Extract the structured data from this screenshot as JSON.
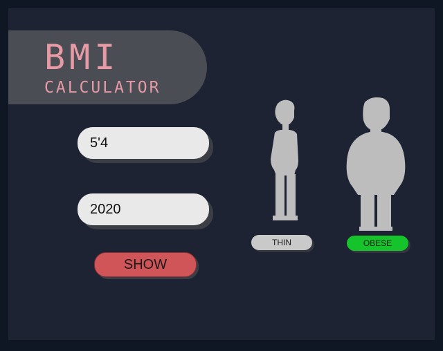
{
  "app": {
    "title": "BMI",
    "subtitle": "CALCULATOR"
  },
  "form": {
    "height_value": "5'4",
    "weight_value": "2020",
    "show_label": "SHOW"
  },
  "categories": [
    {
      "label": "THIN",
      "active": false,
      "color": "#c9c9ca"
    },
    {
      "label": "OBESE",
      "active": true,
      "color": "#14c42a"
    }
  ],
  "colors": {
    "background": "#1d2333",
    "frame": "#0f1624",
    "banner": "#4a4d54",
    "title_text": "#e69aa6",
    "show_button": "#cf5558",
    "silhouette": "#bdbdbd"
  },
  "icons": {
    "thin_figure": "thin-person-silhouette",
    "obese_figure": "obese-person-silhouette"
  }
}
